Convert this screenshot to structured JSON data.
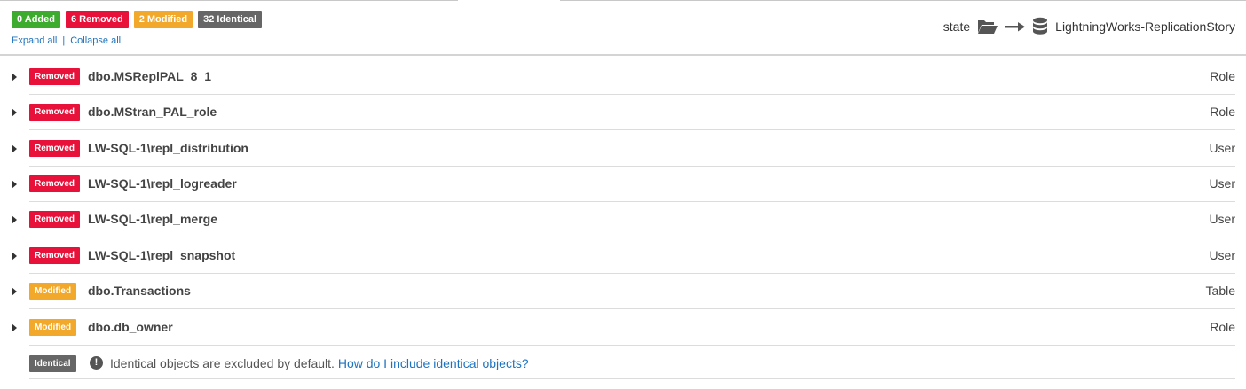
{
  "summary": {
    "added": "0 Added",
    "removed": "6 Removed",
    "modified": "2 Modified",
    "identical": "32 Identical"
  },
  "links": {
    "expand_all": "Expand all",
    "separator": "|",
    "collapse_all": "Collapse all"
  },
  "comparison": {
    "source_label": "state",
    "source_icon": "folder-open-icon",
    "arrow_icon": "arrow-right-icon",
    "target_icon": "database-icon",
    "target_label": "LightningWorks-ReplicationStory"
  },
  "colors": {
    "added": "#3dab2e",
    "removed": "#e8113a",
    "modified": "#f2a82a",
    "identical": "#666666",
    "link": "#1e73be"
  },
  "rows": [
    {
      "status": "Removed",
      "name": "dbo.MSReplPAL_8_1",
      "type": "Role"
    },
    {
      "status": "Removed",
      "name": "dbo.MStran_PAL_role",
      "type": "Role"
    },
    {
      "status": "Removed",
      "name": "LW-SQL-1\\repl_distribution",
      "type": "User"
    },
    {
      "status": "Removed",
      "name": "LW-SQL-1\\repl_logreader",
      "type": "User"
    },
    {
      "status": "Removed",
      "name": "LW-SQL-1\\repl_merge",
      "type": "User"
    },
    {
      "status": "Removed",
      "name": "LW-SQL-1\\repl_snapshot",
      "type": "User"
    },
    {
      "status": "Modified",
      "name": "dbo.Transactions",
      "type": "Table"
    },
    {
      "status": "Modified",
      "name": "dbo.db_owner",
      "type": "Role"
    }
  ],
  "identical_note": {
    "tag": "Identical",
    "info_icon": "info-icon",
    "message": "Identical objects are excluded by default.",
    "link": "How do I include identical objects?"
  }
}
